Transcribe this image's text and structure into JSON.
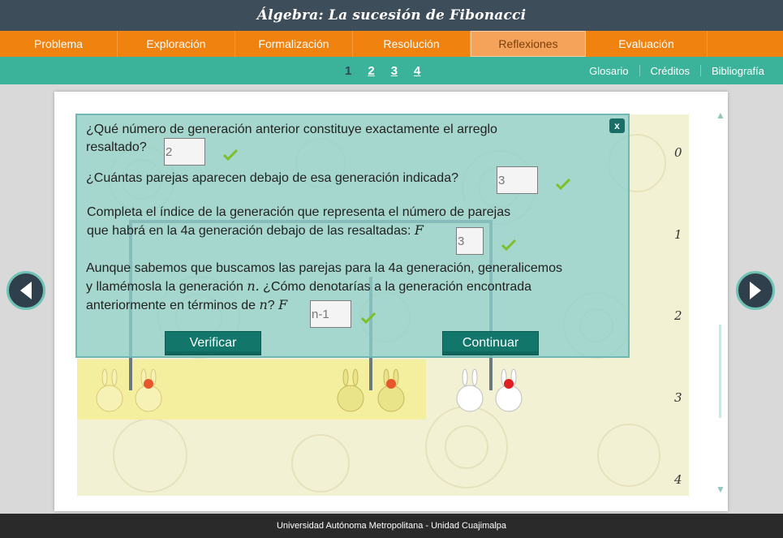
{
  "title": "Álgebra: La sucesión de Fibonacci",
  "nav": {
    "tabs": [
      {
        "label": "Problema",
        "active": false
      },
      {
        "label": "Exploración",
        "active": false
      },
      {
        "label": "Formalización",
        "active": false
      },
      {
        "label": "Resolución",
        "active": false
      },
      {
        "label": "Reflexiones",
        "active": true
      },
      {
        "label": "Evaluación",
        "active": false
      }
    ]
  },
  "subnav": {
    "pages": [
      "1",
      "2",
      "3",
      "4"
    ],
    "current_page": "1",
    "links": [
      "Glosario",
      "Créditos",
      "Bibliografía"
    ]
  },
  "board": {
    "generations": [
      "0",
      "1",
      "2",
      "3",
      "4"
    ]
  },
  "quiz": {
    "close_label": "x",
    "q1": {
      "text": "¿Qué número de generación anterior constituye exactamente el arreglo resaltado?",
      "value": "2",
      "correct": true
    },
    "q2": {
      "text": "¿Cuántas parejas aparecen debajo de esa generación indicada?",
      "value": "3",
      "correct": true
    },
    "q3": {
      "text_a": "Completa el índice de la generación que representa el número de parejas",
      "text_b": "que habrá en la 4a generación debajo de las resaltadas:",
      "symbol": "F",
      "value": "3",
      "correct": true
    },
    "q4": {
      "text_a": "Aunque sabemos que buscamos las parejas para la 4a generación, generalicemos",
      "text_b_pre": "y llamémosla la generación ",
      "text_b_var": "n.",
      "text_b_post": " ¿Cómo denotarías a la generación encontrada",
      "text_c_pre": "anteriormente en términos de ",
      "text_c_var": "n",
      "text_c_post": "?",
      "symbol": "F",
      "value": "n-1",
      "correct": true
    },
    "verify_label": "Verificar",
    "continue_label": "Continuar"
  },
  "footer": "Universidad Autónoma Metropolitana - Unidad Cuajimalpa",
  "colors": {
    "titlebar": "#3e4d5a",
    "nav": "#f0820f",
    "subnav": "#3bb29a",
    "button": "#13766b",
    "check": "#7fbf2a"
  }
}
